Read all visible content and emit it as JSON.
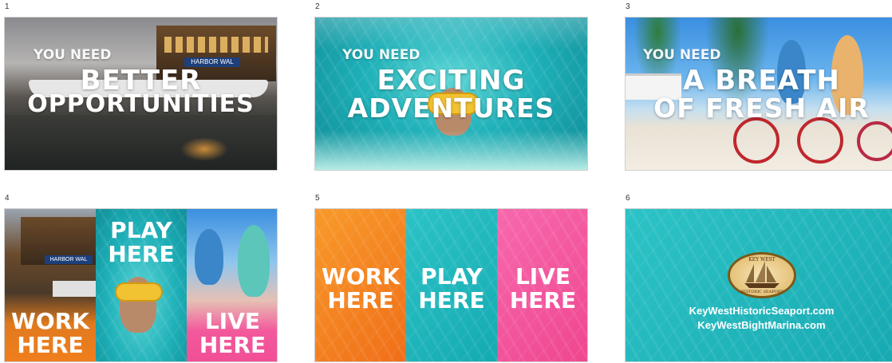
{
  "slides": [
    {
      "number": "1",
      "small": "YOU NEED",
      "line1": "BETTER",
      "line2": "OPPORTUNITIES",
      "sign": "HARBOR WAL"
    },
    {
      "number": "2",
      "small": "YOU NEED",
      "line1": "EXCITING",
      "line2": "ADVENTURES"
    },
    {
      "number": "3",
      "small": "YOU NEED",
      "line1": "A BREATH",
      "line2": "OF FRESH AIR"
    },
    {
      "number": "4",
      "work": [
        "WORK",
        "HERE"
      ],
      "play": [
        "PLAY",
        "HERE"
      ],
      "live": [
        "LIVE",
        "HERE"
      ],
      "sign": "HARBOR WAL"
    },
    {
      "number": "5",
      "work": [
        "WORK",
        "HERE"
      ],
      "play": [
        "PLAY",
        "HERE"
      ],
      "live": [
        "LIVE",
        "HERE"
      ]
    },
    {
      "number": "6",
      "logo_top": "KEY WEST",
      "logo_bottom": "HISTORIC SEAPORT",
      "url1": "KeyWestHistoricSeaport.com",
      "url2": "KeyWestBightMarina.com"
    }
  ],
  "colors": {
    "teal": "#1fb8bd",
    "orange": "#f57b1f",
    "pink": "#f2539c",
    "sea": "#25b6c2"
  }
}
